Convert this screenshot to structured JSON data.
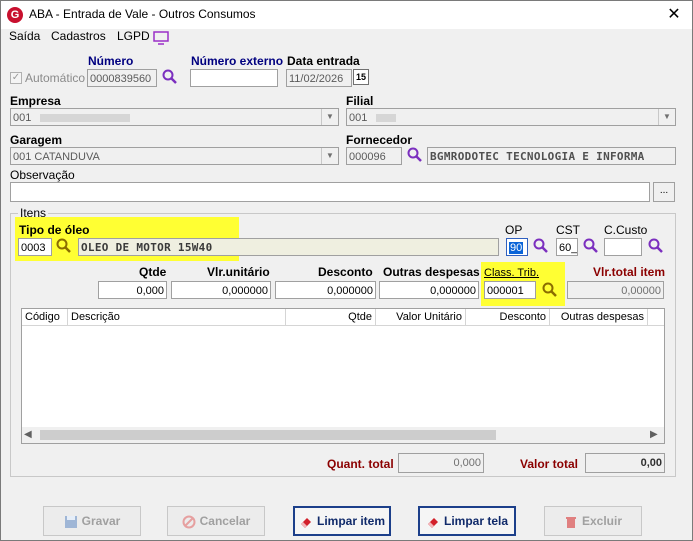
{
  "window": {
    "title": "ABA - Entrada de Vale - Outros Consumos",
    "close": "✕"
  },
  "menu": {
    "items": [
      "Saída",
      "Cadastros",
      "LGPD"
    ]
  },
  "header": {
    "automatico_label": "Automático",
    "numero_label": "Número",
    "numero_value": "0000839560",
    "numero_externo_label": "Número externo",
    "numero_externo_value": "",
    "data_entrada_label": "Data entrada",
    "data_entrada_value": "11/02/2026",
    "empresa_label": "Empresa",
    "empresa_value": "001",
    "filial_label": "Filial",
    "filial_value": "001",
    "garagem_label": "Garagem",
    "garagem_value": "001 CATANDUVA",
    "fornecedor_label": "Fornecedor",
    "fornecedor_code": "000096",
    "fornecedor_name": "BGMRODOTEC TECNOLOGIA E INFORMA",
    "observacao_label": "Observação",
    "observacao_value": "",
    "observacao_button": "..."
  },
  "itens": {
    "group_label": "Itens",
    "tipo_oleo_label": "Tipo de óleo",
    "tipo_oleo_code": "0003",
    "tipo_oleo_name": "OLEO DE MOTOR 15W40",
    "op_label": "OP",
    "op_value": "90",
    "cst_label": "CST",
    "cst_value": "60_",
    "ccusto_label": "C.Custo",
    "ccusto_value": "",
    "qtde_label": "Qtde",
    "qtde_value": "0,000",
    "vlr_unitario_label": "Vlr.unitário",
    "vlr_unitario_value": "0,000000",
    "desconto_label": "Desconto",
    "desconto_value": "0,000000",
    "outras_despesas_label": "Outras despesas",
    "outras_despesas_value": "0,000000",
    "class_trib_label": "Class. Trib.",
    "class_trib_value": "000001",
    "vlr_total_label": "Vlr.total item",
    "vlr_total_value": "0,00000"
  },
  "grid": {
    "columns": [
      "Código",
      "Descrição",
      "Qtde",
      "Valor Unitário",
      "Desconto",
      "Outras despesas"
    ]
  },
  "totals": {
    "quant_label": "Quant. total",
    "quant_value": "0,000",
    "valor_label": "Valor total",
    "valor_value": "0,00"
  },
  "buttons": {
    "gravar": "Gravar",
    "cancelar": "Cancelar",
    "limpar_item": "Limpar item",
    "limpar_tela": "Limpar tela",
    "excluir": "Excluir"
  },
  "colors": {
    "highlight": "#ffff33",
    "accent_red": "#8b0000",
    "navy": "#000080",
    "magnifier": "#7b2fbf"
  }
}
